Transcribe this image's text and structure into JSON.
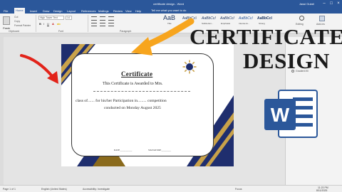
{
  "window": {
    "title": "certificate design - Word",
    "user": "Jassi Gulati"
  },
  "menu": {
    "tabs": [
      "File",
      "Home",
      "Insert",
      "Draw",
      "Design",
      "Layout",
      "References",
      "Mailings",
      "Review",
      "View",
      "Help"
    ],
    "active_tab": "Home",
    "tell_me": "Tell me what you want to do"
  },
  "ribbon": {
    "paste_label": "Paste",
    "cut_label": "Cut",
    "copy_label": "Copy",
    "format_painter_label": "Format Painter",
    "font_name": "High Tower Text",
    "font_size": "14",
    "clipboard_group": "Clipboard",
    "font_group": "Font",
    "paragraph_group": "Paragraph",
    "styles": [
      {
        "sample": "AaB",
        "name": "Title"
      },
      {
        "sample": "AaBbCcI",
        "name": "Subtitle"
      },
      {
        "sample": "AaBbCcI",
        "name": "Subtle Em..."
      },
      {
        "sample": "AaBbCcI",
        "name": "Emphasis"
      },
      {
        "sample": "AaBbCcI",
        "name": "Intense E..."
      },
      {
        "sample": "AaBbCcI",
        "name": "Strong"
      }
    ],
    "editing_label": "Editing",
    "add_ins_label": "Add-ins"
  },
  "document": {
    "certificate_title": "Certificate",
    "line1": "This Certificate is Awarded to Mrs.",
    "line2": "class of....... for his/her Participation in......... competition",
    "line3": "conducted on Monday August 2025",
    "date_label": "DATE__________",
    "signature_label": "SIGNATURE________"
  },
  "side_panel": {
    "gradient_fill_label": "Gradient fill"
  },
  "overlay": {
    "headline_line1": "CERTIFICATE",
    "headline_line2": "DESIGN"
  },
  "status": {
    "page": "Page 1 of 1",
    "language": "English (United States)",
    "accessibility": "Accessibility: Investigate",
    "focus": "Focus",
    "time": "11:23 PM",
    "date": "8/11/2025"
  },
  "colors": {
    "word_blue": "#2b579a",
    "navy": "#1f2e6e",
    "gold": "#c9a24a",
    "arrow_orange": "#f7a51e",
    "arrow_red": "#e2231a",
    "triangle_brown": "#8a6a1c"
  },
  "icons": {
    "word_logo": "word-logo-icon",
    "sun": "sun-emblem-icon",
    "arrow_to_title": "curved-arrow-icon",
    "arrow_to_page": "red-arrow-icon"
  }
}
